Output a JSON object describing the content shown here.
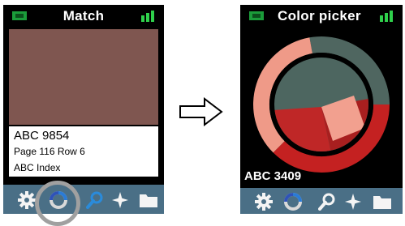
{
  "left_screen": {
    "title": "Match",
    "swatch_color": "#7f5650",
    "code": "ABC 9854",
    "page_row": "Page 116 Row 6",
    "index": "ABC Index",
    "icons": [
      "gear-icon",
      "color-wheel-icon",
      "magnifier-icon",
      "compass-icon",
      "folder-icon"
    ],
    "highlighted_tool": "color-wheel-icon"
  },
  "right_screen": {
    "title": "Color picker",
    "code": "ABC 3409",
    "icons": [
      "gear-icon",
      "color-wheel-icon",
      "magnifier-icon",
      "compass-icon",
      "folder-icon"
    ],
    "colors": {
      "outer_ring_a": "#4f6660",
      "outer_ring_b": "#ef9a88",
      "outer_ring_c": "#c42121",
      "inner_teal": "#4d6660",
      "inner_pink": "#f2a08f",
      "inner_red": "#bf2727"
    }
  },
  "transition_arrow": "arrow-right-icon"
}
